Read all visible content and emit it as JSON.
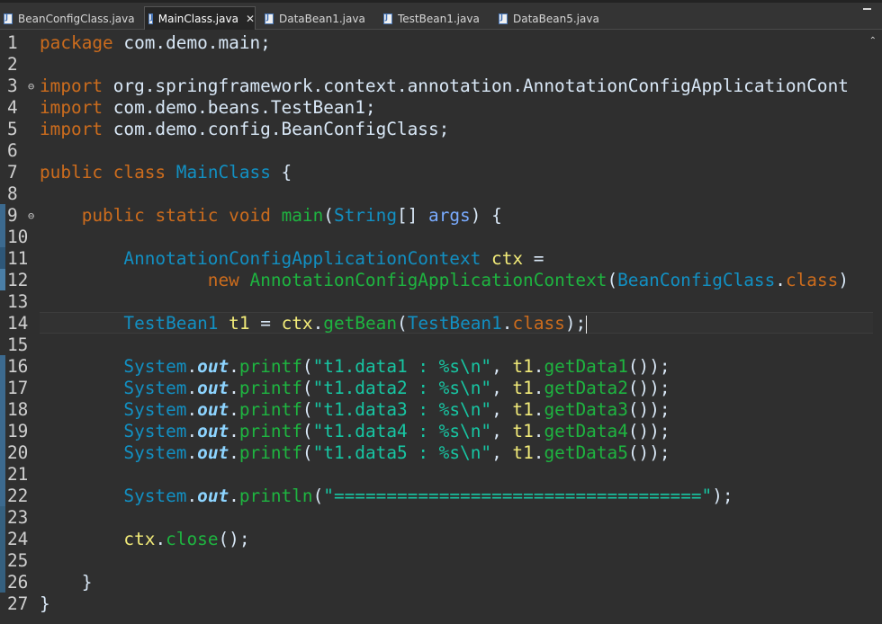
{
  "tabs": [
    {
      "label": "BeanConfigClass.java",
      "active": false
    },
    {
      "label": "MainClass.java",
      "active": true
    },
    {
      "label": "DataBean1.java",
      "active": false
    },
    {
      "label": "TestBean1.java",
      "active": false
    },
    {
      "label": "DataBean5.java",
      "active": false
    }
  ],
  "editor": {
    "current_line": "14",
    "lines": [
      {
        "n": "1",
        "segments": [
          [
            "kw",
            "package"
          ],
          [
            "pl",
            " com.demo.main;"
          ]
        ]
      },
      {
        "n": "2",
        "segments": []
      },
      {
        "n": "3",
        "fold": "⊖",
        "segments": [
          [
            "kw",
            "import"
          ],
          [
            "pl",
            " org.springframework.context.annotation.AnnotationConfigApplicationCont"
          ]
        ]
      },
      {
        "n": "4",
        "segments": [
          [
            "kw",
            "import"
          ],
          [
            "pl",
            " com.demo.beans.TestBean1;"
          ]
        ]
      },
      {
        "n": "5",
        "segments": [
          [
            "kw",
            "import"
          ],
          [
            "pl",
            " com.demo.config.BeanConfigClass;"
          ]
        ]
      },
      {
        "n": "6",
        "segments": []
      },
      {
        "n": "7",
        "segments": [
          [
            "kw",
            "public"
          ],
          [
            "pl",
            " "
          ],
          [
            "kw",
            "class"
          ],
          [
            "pl",
            " "
          ],
          [
            "cls",
            "MainClass"
          ],
          [
            "pl",
            " {"
          ]
        ]
      },
      {
        "n": "8",
        "segments": []
      },
      {
        "n": "9",
        "fold": "⊖",
        "segments": [
          [
            "pl",
            "    "
          ],
          [
            "kw",
            "public"
          ],
          [
            "pl",
            " "
          ],
          [
            "kw",
            "static"
          ],
          [
            "pl",
            " "
          ],
          [
            "kw",
            "void"
          ],
          [
            "pl",
            " "
          ],
          [
            "mth",
            "main"
          ],
          [
            "pl",
            "("
          ],
          [
            "cls",
            "String"
          ],
          [
            "pl",
            "[] "
          ],
          [
            "par",
            "args"
          ],
          [
            "pl",
            ") {"
          ]
        ]
      },
      {
        "n": "10",
        "segments": []
      },
      {
        "n": "11",
        "segments": [
          [
            "pl",
            "        "
          ],
          [
            "cls",
            "AnnotationConfigApplicationContext"
          ],
          [
            "pl",
            " "
          ],
          [
            "var",
            "ctx"
          ],
          [
            "pl",
            " ="
          ]
        ]
      },
      {
        "n": "12",
        "segments": [
          [
            "pl",
            "                "
          ],
          [
            "kw",
            "new"
          ],
          [
            "pl",
            " "
          ],
          [
            "mth",
            "AnnotationConfigApplicationContext"
          ],
          [
            "pl",
            "("
          ],
          [
            "cls",
            "BeanConfigClass"
          ],
          [
            "pl",
            "."
          ],
          [
            "kw",
            "class"
          ],
          [
            "pl",
            ")"
          ]
        ]
      },
      {
        "n": "13",
        "segments": []
      },
      {
        "n": "14",
        "caret": true,
        "segments": [
          [
            "pl",
            "        "
          ],
          [
            "cls",
            "TestBean1"
          ],
          [
            "pl",
            " "
          ],
          [
            "var",
            "t1"
          ],
          [
            "pl",
            " = "
          ],
          [
            "var",
            "ctx"
          ],
          [
            "pl",
            "."
          ],
          [
            "mth",
            "getBean"
          ],
          [
            "pl",
            "("
          ],
          [
            "cls",
            "TestBean1"
          ],
          [
            "pl",
            "."
          ],
          [
            "kw",
            "class"
          ],
          [
            "pl",
            ");"
          ]
        ]
      },
      {
        "n": "15",
        "segments": []
      },
      {
        "n": "16",
        "segments": [
          [
            "pl",
            "        "
          ],
          [
            "cls",
            "System"
          ],
          [
            "pl",
            "."
          ],
          [
            "fld",
            "out"
          ],
          [
            "pl",
            "."
          ],
          [
            "mth",
            "printf"
          ],
          [
            "pl",
            "("
          ],
          [
            "str",
            "\"t1.data1 : %s\\n\""
          ],
          [
            "pl",
            ", "
          ],
          [
            "var",
            "t1"
          ],
          [
            "pl",
            "."
          ],
          [
            "mth",
            "getData1"
          ],
          [
            "pl",
            "());"
          ]
        ]
      },
      {
        "n": "17",
        "segments": [
          [
            "pl",
            "        "
          ],
          [
            "cls",
            "System"
          ],
          [
            "pl",
            "."
          ],
          [
            "fld",
            "out"
          ],
          [
            "pl",
            "."
          ],
          [
            "mth",
            "printf"
          ],
          [
            "pl",
            "("
          ],
          [
            "str",
            "\"t1.data2 : %s\\n\""
          ],
          [
            "pl",
            ", "
          ],
          [
            "var",
            "t1"
          ],
          [
            "pl",
            "."
          ],
          [
            "mth",
            "getData2"
          ],
          [
            "pl",
            "());"
          ]
        ]
      },
      {
        "n": "18",
        "segments": [
          [
            "pl",
            "        "
          ],
          [
            "cls",
            "System"
          ],
          [
            "pl",
            "."
          ],
          [
            "fld",
            "out"
          ],
          [
            "pl",
            "."
          ],
          [
            "mth",
            "printf"
          ],
          [
            "pl",
            "("
          ],
          [
            "str",
            "\"t1.data3 : %s\\n\""
          ],
          [
            "pl",
            ", "
          ],
          [
            "var",
            "t1"
          ],
          [
            "pl",
            "."
          ],
          [
            "mth",
            "getData3"
          ],
          [
            "pl",
            "());"
          ]
        ]
      },
      {
        "n": "19",
        "segments": [
          [
            "pl",
            "        "
          ],
          [
            "cls",
            "System"
          ],
          [
            "pl",
            "."
          ],
          [
            "fld",
            "out"
          ],
          [
            "pl",
            "."
          ],
          [
            "mth",
            "printf"
          ],
          [
            "pl",
            "("
          ],
          [
            "str",
            "\"t1.data4 : %s\\n\""
          ],
          [
            "pl",
            ", "
          ],
          [
            "var",
            "t1"
          ],
          [
            "pl",
            "."
          ],
          [
            "mth",
            "getData4"
          ],
          [
            "pl",
            "());"
          ]
        ]
      },
      {
        "n": "20",
        "segments": [
          [
            "pl",
            "        "
          ],
          [
            "cls",
            "System"
          ],
          [
            "pl",
            "."
          ],
          [
            "fld",
            "out"
          ],
          [
            "pl",
            "."
          ],
          [
            "mth",
            "printf"
          ],
          [
            "pl",
            "("
          ],
          [
            "str",
            "\"t1.data5 : %s\\n\""
          ],
          [
            "pl",
            ", "
          ],
          [
            "var",
            "t1"
          ],
          [
            "pl",
            "."
          ],
          [
            "mth",
            "getData5"
          ],
          [
            "pl",
            "());"
          ]
        ]
      },
      {
        "n": "21",
        "segments": []
      },
      {
        "n": "22",
        "segments": [
          [
            "pl",
            "        "
          ],
          [
            "cls",
            "System"
          ],
          [
            "pl",
            "."
          ],
          [
            "fld",
            "out"
          ],
          [
            "pl",
            "."
          ],
          [
            "mth",
            "println"
          ],
          [
            "pl",
            "("
          ],
          [
            "str",
            "\"===================================\""
          ],
          [
            "pl",
            ");"
          ]
        ]
      },
      {
        "n": "23",
        "segments": []
      },
      {
        "n": "24",
        "segments": [
          [
            "pl",
            "        "
          ],
          [
            "var",
            "ctx"
          ],
          [
            "pl",
            "."
          ],
          [
            "mth",
            "close"
          ],
          [
            "pl",
            "();"
          ]
        ]
      },
      {
        "n": "25",
        "segments": []
      },
      {
        "n": "26",
        "segments": [
          [
            "pl",
            "    }"
          ]
        ]
      },
      {
        "n": "27",
        "segments": [
          [
            "pl",
            "}"
          ]
        ]
      }
    ]
  },
  "colors": {
    "background": "#2f2f2f",
    "keyword": "#cc6c1d",
    "class": "#1290c3",
    "method": "#1eb540",
    "variable": "#f3ec79",
    "string": "#17c6a3",
    "static_field": "#8dd4ff",
    "parameter": "#79abff",
    "text": "#d9e8f7"
  },
  "icons": {
    "tab_file": "java-file-icon",
    "tab_close": "close-icon",
    "minimize": "minimize-icon",
    "fold": "fold-collapse-icon",
    "scroll": "scroll-up-icon"
  }
}
